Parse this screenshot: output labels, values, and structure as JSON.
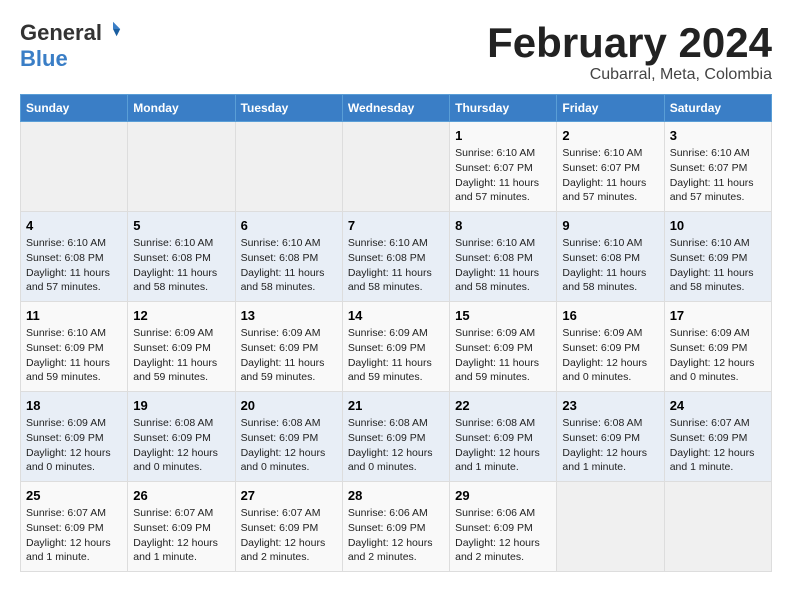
{
  "logo": {
    "general": "General",
    "blue": "Blue"
  },
  "header": {
    "month": "February 2024",
    "location": "Cubarral, Meta, Colombia"
  },
  "weekdays": [
    "Sunday",
    "Monday",
    "Tuesday",
    "Wednesday",
    "Thursday",
    "Friday",
    "Saturday"
  ],
  "weeks": [
    [
      {
        "day": "",
        "info": ""
      },
      {
        "day": "",
        "info": ""
      },
      {
        "day": "",
        "info": ""
      },
      {
        "day": "",
        "info": ""
      },
      {
        "day": "1",
        "info": "Sunrise: 6:10 AM\nSunset: 6:07 PM\nDaylight: 11 hours\nand 57 minutes."
      },
      {
        "day": "2",
        "info": "Sunrise: 6:10 AM\nSunset: 6:07 PM\nDaylight: 11 hours\nand 57 minutes."
      },
      {
        "day": "3",
        "info": "Sunrise: 6:10 AM\nSunset: 6:07 PM\nDaylight: 11 hours\nand 57 minutes."
      }
    ],
    [
      {
        "day": "4",
        "info": "Sunrise: 6:10 AM\nSunset: 6:08 PM\nDaylight: 11 hours\nand 57 minutes."
      },
      {
        "day": "5",
        "info": "Sunrise: 6:10 AM\nSunset: 6:08 PM\nDaylight: 11 hours\nand 58 minutes."
      },
      {
        "day": "6",
        "info": "Sunrise: 6:10 AM\nSunset: 6:08 PM\nDaylight: 11 hours\nand 58 minutes."
      },
      {
        "day": "7",
        "info": "Sunrise: 6:10 AM\nSunset: 6:08 PM\nDaylight: 11 hours\nand 58 minutes."
      },
      {
        "day": "8",
        "info": "Sunrise: 6:10 AM\nSunset: 6:08 PM\nDaylight: 11 hours\nand 58 minutes."
      },
      {
        "day": "9",
        "info": "Sunrise: 6:10 AM\nSunset: 6:08 PM\nDaylight: 11 hours\nand 58 minutes."
      },
      {
        "day": "10",
        "info": "Sunrise: 6:10 AM\nSunset: 6:09 PM\nDaylight: 11 hours\nand 58 minutes."
      }
    ],
    [
      {
        "day": "11",
        "info": "Sunrise: 6:10 AM\nSunset: 6:09 PM\nDaylight: 11 hours\nand 59 minutes."
      },
      {
        "day": "12",
        "info": "Sunrise: 6:09 AM\nSunset: 6:09 PM\nDaylight: 11 hours\nand 59 minutes."
      },
      {
        "day": "13",
        "info": "Sunrise: 6:09 AM\nSunset: 6:09 PM\nDaylight: 11 hours\nand 59 minutes."
      },
      {
        "day": "14",
        "info": "Sunrise: 6:09 AM\nSunset: 6:09 PM\nDaylight: 11 hours\nand 59 minutes."
      },
      {
        "day": "15",
        "info": "Sunrise: 6:09 AM\nSunset: 6:09 PM\nDaylight: 11 hours\nand 59 minutes."
      },
      {
        "day": "16",
        "info": "Sunrise: 6:09 AM\nSunset: 6:09 PM\nDaylight: 12 hours\nand 0 minutes."
      },
      {
        "day": "17",
        "info": "Sunrise: 6:09 AM\nSunset: 6:09 PM\nDaylight: 12 hours\nand 0 minutes."
      }
    ],
    [
      {
        "day": "18",
        "info": "Sunrise: 6:09 AM\nSunset: 6:09 PM\nDaylight: 12 hours\nand 0 minutes."
      },
      {
        "day": "19",
        "info": "Sunrise: 6:08 AM\nSunset: 6:09 PM\nDaylight: 12 hours\nand 0 minutes."
      },
      {
        "day": "20",
        "info": "Sunrise: 6:08 AM\nSunset: 6:09 PM\nDaylight: 12 hours\nand 0 minutes."
      },
      {
        "day": "21",
        "info": "Sunrise: 6:08 AM\nSunset: 6:09 PM\nDaylight: 12 hours\nand 0 minutes."
      },
      {
        "day": "22",
        "info": "Sunrise: 6:08 AM\nSunset: 6:09 PM\nDaylight: 12 hours\nand 1 minute."
      },
      {
        "day": "23",
        "info": "Sunrise: 6:08 AM\nSunset: 6:09 PM\nDaylight: 12 hours\nand 1 minute."
      },
      {
        "day": "24",
        "info": "Sunrise: 6:07 AM\nSunset: 6:09 PM\nDaylight: 12 hours\nand 1 minute."
      }
    ],
    [
      {
        "day": "25",
        "info": "Sunrise: 6:07 AM\nSunset: 6:09 PM\nDaylight: 12 hours\nand 1 minute."
      },
      {
        "day": "26",
        "info": "Sunrise: 6:07 AM\nSunset: 6:09 PM\nDaylight: 12 hours\nand 1 minute."
      },
      {
        "day": "27",
        "info": "Sunrise: 6:07 AM\nSunset: 6:09 PM\nDaylight: 12 hours\nand 2 minutes."
      },
      {
        "day": "28",
        "info": "Sunrise: 6:06 AM\nSunset: 6:09 PM\nDaylight: 12 hours\nand 2 minutes."
      },
      {
        "day": "29",
        "info": "Sunrise: 6:06 AM\nSunset: 6:09 PM\nDaylight: 12 hours\nand 2 minutes."
      },
      {
        "day": "",
        "info": ""
      },
      {
        "day": "",
        "info": ""
      }
    ]
  ]
}
